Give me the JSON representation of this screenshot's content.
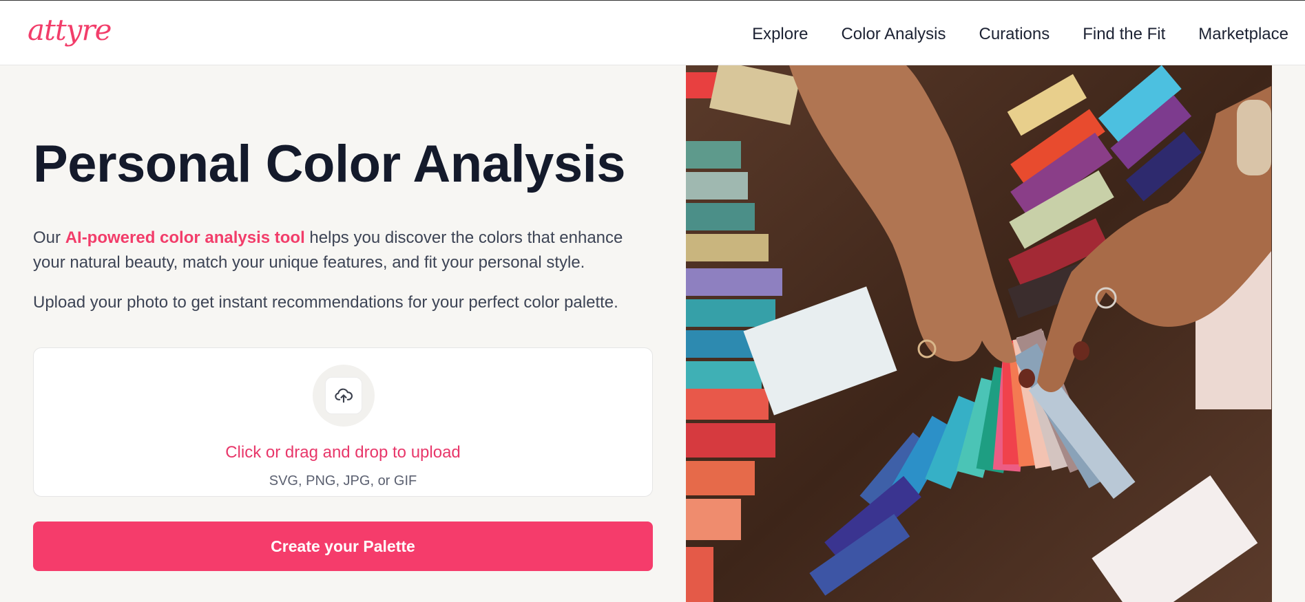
{
  "brand": {
    "logo_text": "attyre"
  },
  "nav": {
    "items": [
      "Explore",
      "Color Analysis",
      "Curations",
      "Find the Fit",
      "Marketplace"
    ]
  },
  "hero": {
    "title": "Personal Color Analysis",
    "para1_pre": "Our ",
    "para1_highlight": "AI-powered color analysis tool",
    "para1_post": " helps you discover the colors that enhance your natural beauty, match your unique features, and fit your personal style.",
    "para2": "Upload your photo to get instant recommendations for your perfect color palette."
  },
  "upload": {
    "icon": "cloud-upload-icon",
    "label": "Click or drag and drop to upload",
    "formats": "SVG, PNG, JPG, or GIF"
  },
  "cta": {
    "label": "Create your Palette"
  },
  "colors": {
    "accent": "#f53c6b",
    "text_dark": "#141a2b",
    "background": "#f7f6f3"
  }
}
